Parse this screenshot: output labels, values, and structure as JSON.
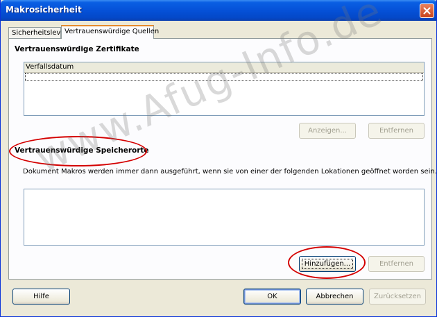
{
  "window": {
    "title": "Makrosicherheit"
  },
  "tabs": [
    {
      "label": "Sicherheitslevel",
      "active": false
    },
    {
      "label": "Vertrauenswürdige Quellen",
      "active": true
    }
  ],
  "certificates": {
    "title": "Vertrauenswürdige Zertifikate",
    "columns": [
      "Verfallsdatum"
    ],
    "rows": [],
    "view_button": "Anzeigen...",
    "remove_button": "Entfernen"
  },
  "locations": {
    "title": "Vertrauenswürdige Speicherorte",
    "description": "Dokument Makros werden immer dann ausgeführt, wenn sie von einer der folgenden Lokationen geöffnet worden sein.",
    "items": [],
    "add_button": "Hinzufügen...",
    "remove_button": "Entfernen"
  },
  "footer": {
    "help_button": "Hilfe",
    "ok_button": "OK",
    "cancel_button": "Abbrechen",
    "reset_button": "Zurücksetzen"
  },
  "watermark": "www.Afug-Info.de",
  "annotation_color": "#d40000"
}
